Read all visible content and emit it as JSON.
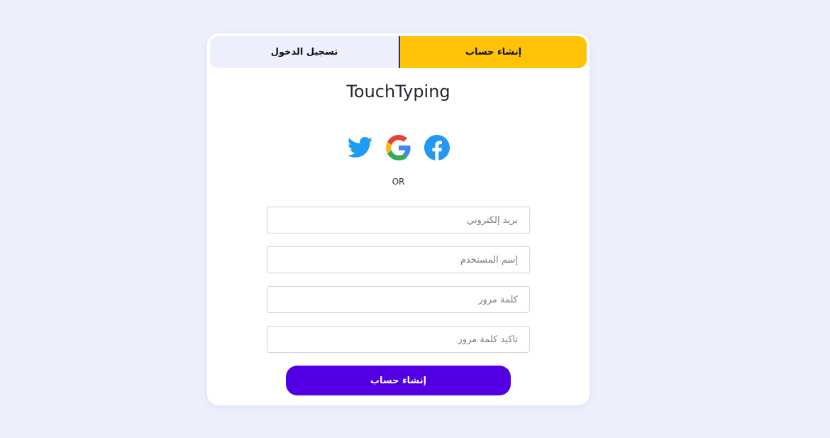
{
  "tabs": {
    "login_label": "تسجيل الدخول",
    "signup_label": "إنشاء حساب",
    "active": "signup"
  },
  "brand": {
    "title": "TouchTyping"
  },
  "social": {
    "icons": [
      "twitter-icon",
      "google-icon",
      "facebook-icon"
    ]
  },
  "divider": {
    "label": "OR"
  },
  "form": {
    "email_placeholder": "بريد إلكتروني",
    "username_placeholder": "إسم المستخدم",
    "password_placeholder": "كلمة مرور",
    "confirm_password_placeholder": "تأكيد كلمة مرور",
    "submit_label": "إنشاء حساب"
  },
  "colors": {
    "background": "#eeeffd",
    "card": "#ffffff",
    "active_tab": "#fec207",
    "inactive_tab": "#eeeffd",
    "primary_button": "#5200e3",
    "twitter": "#1d9bf0",
    "facebook": "#1877f2"
  }
}
